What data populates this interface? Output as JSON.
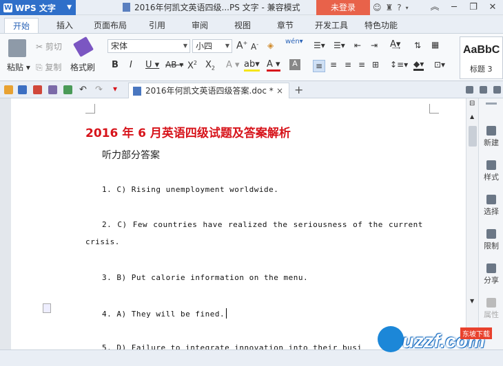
{
  "titlebar": {
    "app_name": "WPS 文字",
    "doc_title": "2016年何凯文英语四级...PS 文字 - 兼容模式",
    "login": "未登录"
  },
  "tabs": [
    "开始",
    "插入",
    "页面布局",
    "引用",
    "审阅",
    "视图",
    "章节",
    "开发工具",
    "特色功能"
  ],
  "ribbon": {
    "paste": "粘贴",
    "cut": "剪切",
    "copy": "复制",
    "format_painter": "格式刷",
    "font_name": "宋体",
    "font_size": "小四",
    "style_preview": "AaBbC",
    "style_name": "标题 3"
  },
  "doc_tab": {
    "name": "2016年何凯文英语四级答案.doc *"
  },
  "document": {
    "title": "2016 年 6 月英语四级试题及答案解析",
    "section": "听力部分答案",
    "answers": [
      "1. C)  Rising unemployment worldwide.",
      "2. C)  Few countries have realized the seriousness of the current",
      "crisis.",
      "3. B)  Put calorie information on the menu.",
      "4. A)  They will be fined.",
      "5. D)  Failure to integrate innovation into their busi"
    ]
  },
  "right_panel": [
    "新建",
    "样式",
    "选择",
    "限制",
    "分享",
    "属性"
  ],
  "watermark": {
    "text": "uzzf.com",
    "badge": "东坡下载"
  }
}
